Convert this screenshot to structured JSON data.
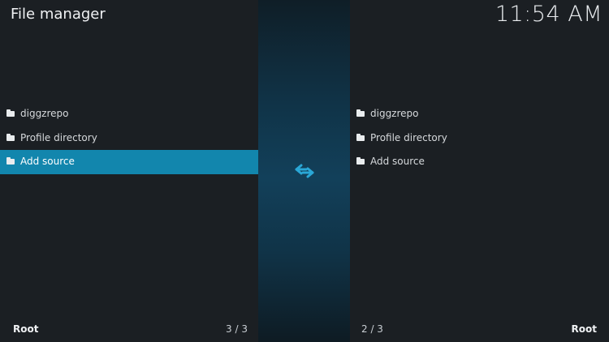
{
  "header": {
    "title": "File manager",
    "clock": "11:54 AM"
  },
  "left_pane": {
    "items": [
      {
        "label": "diggzrepo",
        "icon": "folder-icon"
      },
      {
        "label": "Profile directory",
        "icon": "folder-icon"
      },
      {
        "label": "Add source",
        "icon": "folder-icon",
        "selected": true
      }
    ],
    "path_label": "Root",
    "count": "3 / 3"
  },
  "right_pane": {
    "items": [
      {
        "label": "diggzrepo",
        "icon": "folder-icon"
      },
      {
        "label": "Profile directory",
        "icon": "folder-icon"
      },
      {
        "label": "Add source",
        "icon": "folder-icon"
      }
    ],
    "path_label": "Root",
    "count": "2 / 3"
  },
  "swap": {
    "icon": "swap-arrows-icon",
    "color": "#2aa7d6"
  },
  "colors": {
    "selection": "#1286ad",
    "pane_background": "#1b1f23",
    "divider_accent": "#12405a"
  }
}
